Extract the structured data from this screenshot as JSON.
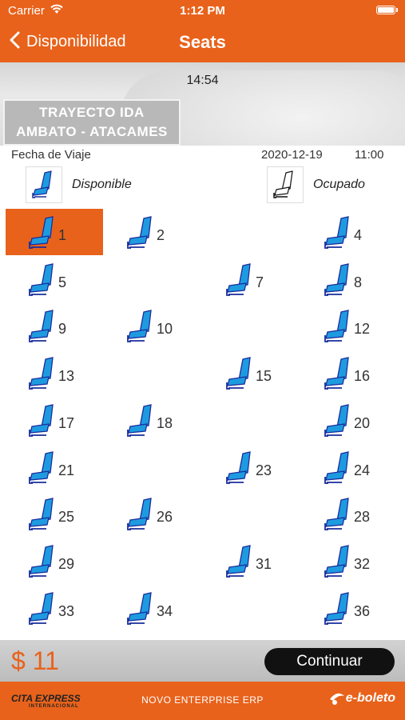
{
  "status_bar": {
    "carrier": "Carrier",
    "time": "1:12 PM"
  },
  "nav": {
    "back_label": "Disponibilidad",
    "title": "Seats"
  },
  "hero": {
    "clock": "14:54",
    "route_line1": "TRAYECTO IDA",
    "route_line2": "AMBATO - ATACAMES"
  },
  "trip": {
    "date_label": "Fecha de Viaje",
    "date": "2020-12-19",
    "time": "11:00"
  },
  "legend": {
    "available": "Disponible",
    "occupied": "Ocupado"
  },
  "seats": [
    {
      "number": "1",
      "selected": true
    },
    {
      "number": "2",
      "selected": false
    },
    {
      "number": "4",
      "selected": false
    },
    {
      "number": "5",
      "selected": false
    },
    {
      "number": "7",
      "selected": false
    },
    {
      "number": "8",
      "selected": false
    },
    {
      "number": "9",
      "selected": false
    },
    {
      "number": "10",
      "selected": false
    },
    {
      "number": "12",
      "selected": false
    },
    {
      "number": "13",
      "selected": false
    },
    {
      "number": "15",
      "selected": false
    },
    {
      "number": "16",
      "selected": false
    },
    {
      "number": "17",
      "selected": false
    },
    {
      "number": "18",
      "selected": false
    },
    {
      "number": "20",
      "selected": false
    },
    {
      "number": "21",
      "selected": false
    },
    {
      "number": "23",
      "selected": false
    },
    {
      "number": "24",
      "selected": false
    },
    {
      "number": "25",
      "selected": false
    },
    {
      "number": "26",
      "selected": false
    },
    {
      "number": "28",
      "selected": false
    },
    {
      "number": "29",
      "selected": false
    },
    {
      "number": "31",
      "selected": false
    },
    {
      "number": "32",
      "selected": false
    },
    {
      "number": "33",
      "selected": false
    },
    {
      "number": "34",
      "selected": false
    },
    {
      "number": "36",
      "selected": false
    }
  ],
  "bottom": {
    "price": "$ 11",
    "continue_label": "Continuar"
  },
  "footer": {
    "left_logo": "CITA EXPRESS",
    "left_logo_sub": "INTERNACIONAL",
    "center": "NOVO ENTERPRISE ERP",
    "right_logo": "e-boleto"
  },
  "colors": {
    "accent": "#e8621b",
    "seat_blue": "#1e9be0",
    "seat_dark": "#1a2d9c"
  },
  "icons": {
    "back": "chevron-left-icon",
    "wifi": "wifi-icon",
    "battery": "battery-icon",
    "seat": "seat-icon"
  }
}
